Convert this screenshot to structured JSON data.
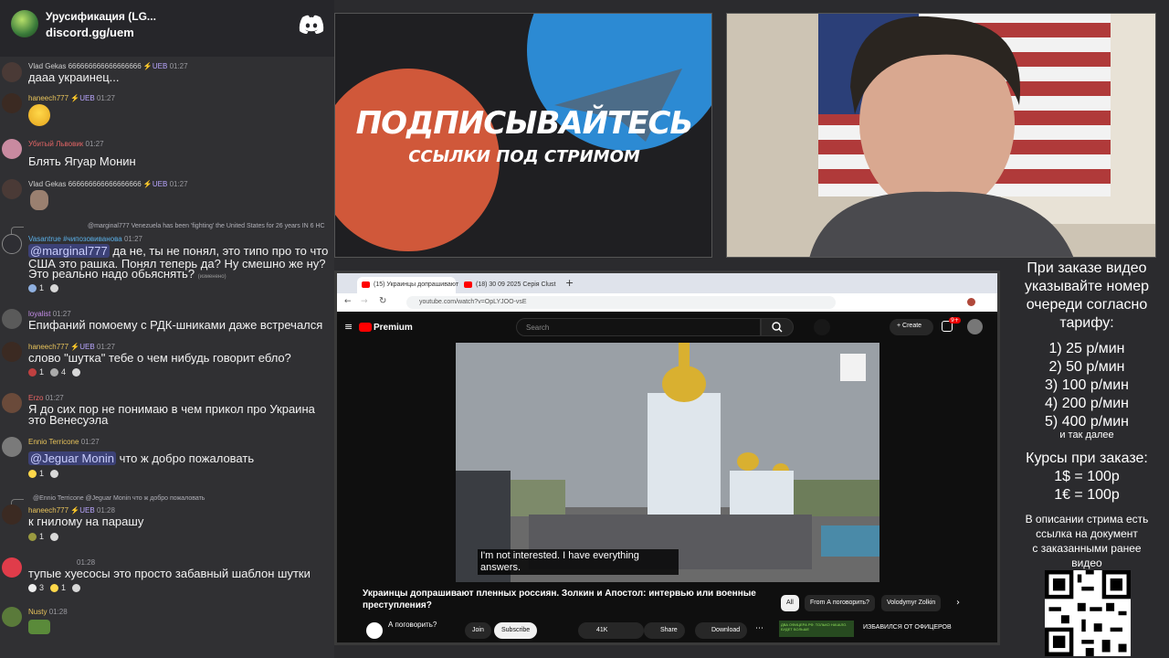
{
  "chat": {
    "server_name": "Урусификация (LG...",
    "server_invite": "discord.gg/uem",
    "messages": [
      {
        "user": "Vlad Gekas 666666666666666666",
        "badge": "⚡UEB",
        "time": "01:27",
        "text": "дааа украинец...",
        "user_color": "#d0d0d0"
      },
      {
        "user": "haneech777",
        "badge": "⚡UEB",
        "time": "01:27",
        "text": "",
        "user_color": "#e8c35b"
      },
      {
        "user": "Убитый Львовик",
        "badge": "",
        "time": "01:27",
        "text": "Блять Ягуар Монин",
        "user_color": "#e06464"
      },
      {
        "user": "Vlad Gekas 666666666666666666",
        "badge": "⚡UEB",
        "time": "01:27",
        "text": "",
        "user_color": "#d0d0d0"
      },
      {
        "user": "Vasantrue #чипозовиванова",
        "badge": "",
        "time": "01:27",
        "text": "да не, ты не понял, это типо про то что",
        "text2": "США это рашка. Понял теперь да? Ну смешно же ну?",
        "text3": "Это реально надо обьяснять?",
        "edited": "(изменено)",
        "mention": "@marginal777",
        "reply": "@marginal777 Venezuela has been 'fighting' the United States for 26 years  IN 6 HC",
        "user_color": "#5ab0e8",
        "reacts": [
          "1"
        ]
      },
      {
        "user": "loyalist",
        "badge": "",
        "time": "01:27",
        "text": "Епифаний помоему с РДК-шниками даже встречался",
        "user_color": "#c48de8"
      },
      {
        "user": "haneech777",
        "badge": "⚡UEB",
        "time": "01:27",
        "text": "слово \"шутка\" тебе о чем нибудь говорит еблo?",
        "user_color": "#e8c35b",
        "reacts": [
          "1",
          "4"
        ]
      },
      {
        "user": "Erzo",
        "badge": "",
        "time": "01:27",
        "text": "Я до сих пор не понимаю в чем прикол про Украина",
        "text2": "это Венесуэла",
        "user_color": "#e86464"
      },
      {
        "user": "Ennio Terricone",
        "badge": "",
        "time": "01:27",
        "text": "что ж добро пожаловать",
        "mention": "@Jeguar Monin",
        "user_color": "#e8c35b",
        "reacts": [
          "1"
        ]
      },
      {
        "user": "haneech777",
        "badge": "⚡UEB",
        "time": "01:28",
        "text": "к гнилому на парашу",
        "reply": "@Ennio Terricone  @Jeguar Monin что ж добро пожаловать",
        "user_color": "#e8c35b",
        "reacts": [
          "1"
        ]
      },
      {
        "user": "",
        "badge": "",
        "time": "01:28",
        "text": "тупые хуесосы это просто забавный шаблон шутки",
        "user_color": "#d0d0d0",
        "reacts": [
          "3",
          "1"
        ]
      },
      {
        "user": "Nusty",
        "badge": "",
        "time": "01:28",
        "text": "",
        "user_color": "#e8c35b"
      }
    ]
  },
  "promo": {
    "title": "ПОДПИСЫВАЙТЕСЬ",
    "subtitle": "ССЫЛКИ ПОД СТРИМОМ"
  },
  "browser": {
    "tab1": "(15) Украинцы допрашивают",
    "tab2": "(18) 30 09 2025 Серія Clust",
    "url": "youtube.com/watch?v=OpLYJOO-vsE",
    "yt_logo": "Premium",
    "search_placeholder": "Search",
    "create_label": "Create",
    "notif_count": "9+",
    "subtitle_line1": "I'm not interested. I have everything",
    "subtitle_line2": "answers.",
    "video_title": "Украинцы допрашивают пленных россиян. Золкин и Апостол: интервью или военные преступления?",
    "chips": [
      "All",
      "From А поговорить?",
      "Volodymyr Zolkin"
    ],
    "channel": "А поговорить?",
    "join": "Join",
    "subscribe": "Subscribe",
    "likes": "41K",
    "share": "Share",
    "download": "Download",
    "related_title": "ИЗБАВИЛСЯ ОТ ОФИЦЕРОВ",
    "related_thumb": "ДВА ОФИЦЕРА РФ. ТОЛЬКО НАЧАЛО. БУДЕТ БОЛЬШЕ"
  },
  "info": {
    "order_lines": [
      "При заказе видео",
      "указывайте номер",
      "очереди согласно",
      "тарифу:"
    ],
    "rates": [
      "1) 25 р/мин",
      "2) 50 р/мин",
      "3) 100 р/мин",
      "4) 200 р/мин",
      "5) 400 р/мин"
    ],
    "etc": "и так далее",
    "courses_title": "Курсы при заказе:",
    "courses": [
      "1$ = 100р",
      "1€ = 100р"
    ],
    "desc_lines": [
      "В описании стрима есть",
      "ссылка на документ",
      "с заказанными ранее",
      "видео"
    ]
  }
}
